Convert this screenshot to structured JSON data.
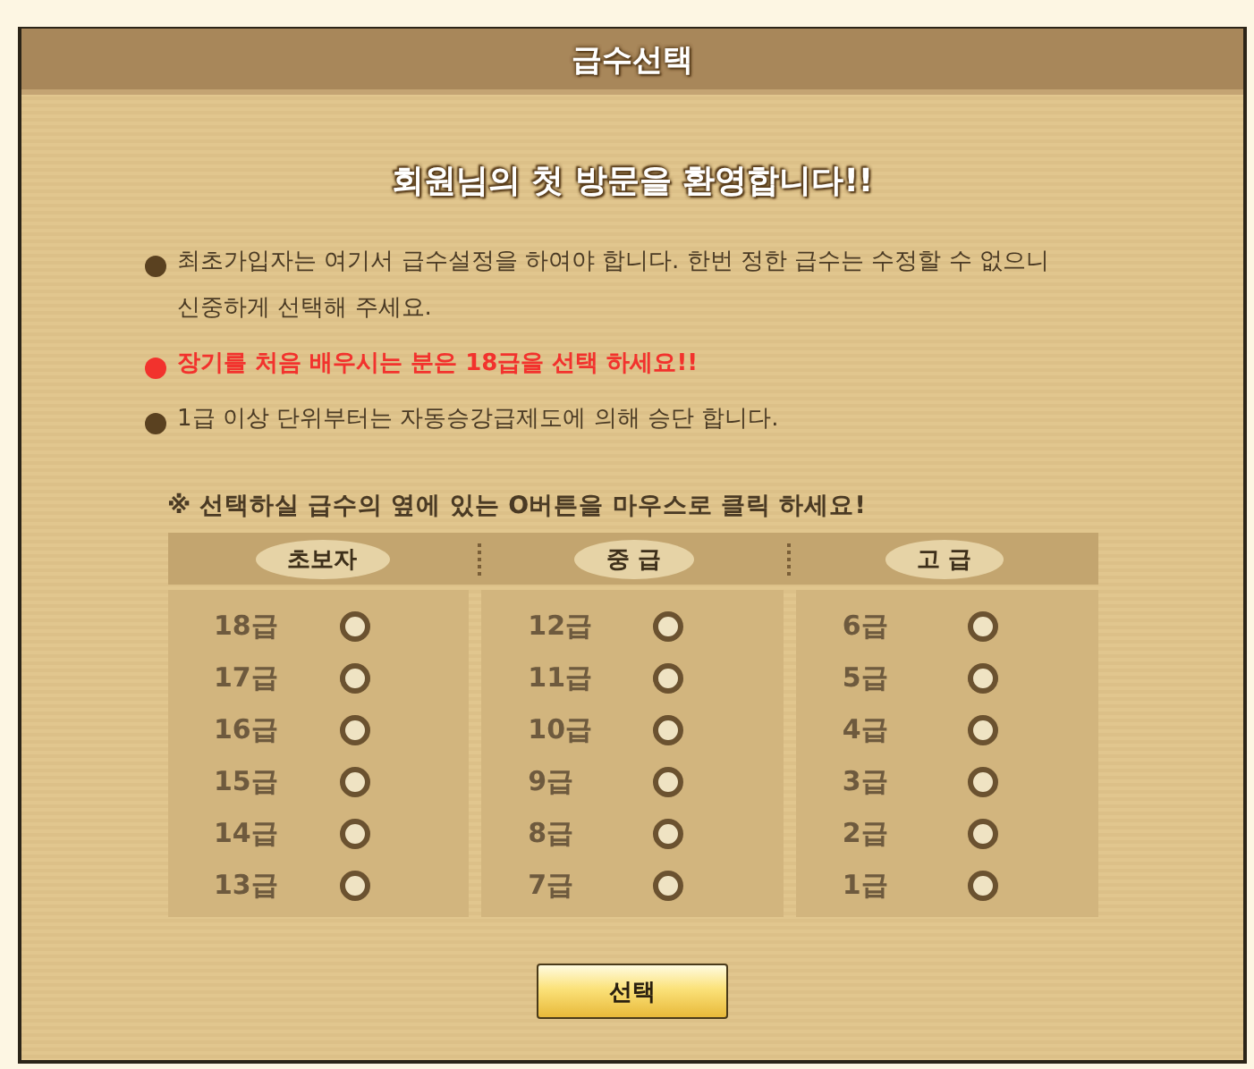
{
  "window": {
    "title": "급수선택"
  },
  "welcome": "회원님의 첫 방문을 환영합니다!!",
  "notices": [
    {
      "text": "최초가입자는 여기서 급수설정을 하여야 합니다. 한번 정한 급수는 수정할 수 없으니 신중하게 선택해 주세요.",
      "highlight": false
    },
    {
      "text": "장기를 처음 배우시는 분은 18급을 선택 하세요!!",
      "highlight": true
    },
    {
      "text": "1급 이상 단위부터는 자동승강급제도에 의해 승단 합니다.",
      "highlight": false
    }
  ],
  "instruction": "※ 선택하실 급수의 옆에 있는 O버튼을 마우스로 클릭 하세요!",
  "groups": [
    {
      "title": "초보자",
      "ranks": [
        {
          "label": "18급",
          "selected": false
        },
        {
          "label": "17급",
          "selected": false
        },
        {
          "label": "16급",
          "selected": false
        },
        {
          "label": "15급",
          "selected": false
        },
        {
          "label": "14급",
          "selected": false
        },
        {
          "label": "13급",
          "selected": false
        }
      ]
    },
    {
      "title": "중 급",
      "ranks": [
        {
          "label": "12급",
          "selected": false
        },
        {
          "label": "11급",
          "selected": false
        },
        {
          "label": "10급",
          "selected": false
        },
        {
          "label": "9급",
          "selected": false
        },
        {
          "label": "8급",
          "selected": false
        },
        {
          "label": "7급",
          "selected": false
        }
      ]
    },
    {
      "title": "고 급",
      "ranks": [
        {
          "label": "6급",
          "selected": false
        },
        {
          "label": "5급",
          "selected": false
        },
        {
          "label": "4급",
          "selected": false
        },
        {
          "label": "3급",
          "selected": false
        },
        {
          "label": "2급",
          "selected": false
        },
        {
          "label": "1급",
          "selected": false
        }
      ]
    }
  ],
  "button": "선택"
}
